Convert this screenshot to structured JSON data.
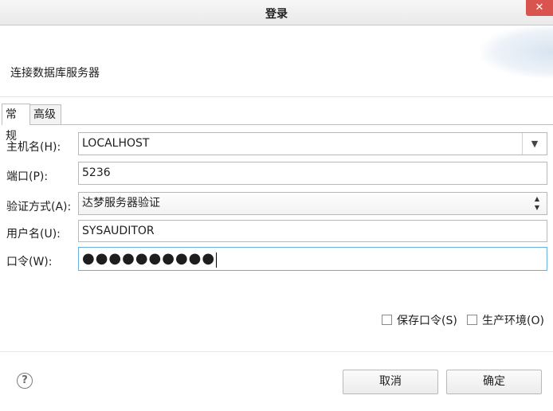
{
  "window": {
    "title": "登录",
    "close_glyph": "✕"
  },
  "header": {
    "text": "连接数据库服务器"
  },
  "tabs": [
    {
      "label": "常规",
      "active": true
    },
    {
      "label": "高级",
      "active": false
    }
  ],
  "form": {
    "host": {
      "label": "主机名(H):",
      "value": "LOCALHOST",
      "dropdown_glyph": "▼"
    },
    "port": {
      "label": "端口(P):",
      "value": "5236"
    },
    "auth": {
      "label": "验证方式(A):",
      "value": "达梦服务器验证",
      "spin_up": "▲",
      "spin_down": "▼"
    },
    "user": {
      "label": "用户名(U):",
      "value": "SYSAUDITOR"
    },
    "password": {
      "label": "口令(W):",
      "masked": "●●●●●●●●●●"
    }
  },
  "options": {
    "save_password": {
      "label": "保存口令(S)",
      "checked": false
    },
    "production_env": {
      "label": "生产环境(O)",
      "checked": false
    }
  },
  "footer": {
    "help_glyph": "?",
    "cancel_label": "取消",
    "ok_label": "确定"
  }
}
